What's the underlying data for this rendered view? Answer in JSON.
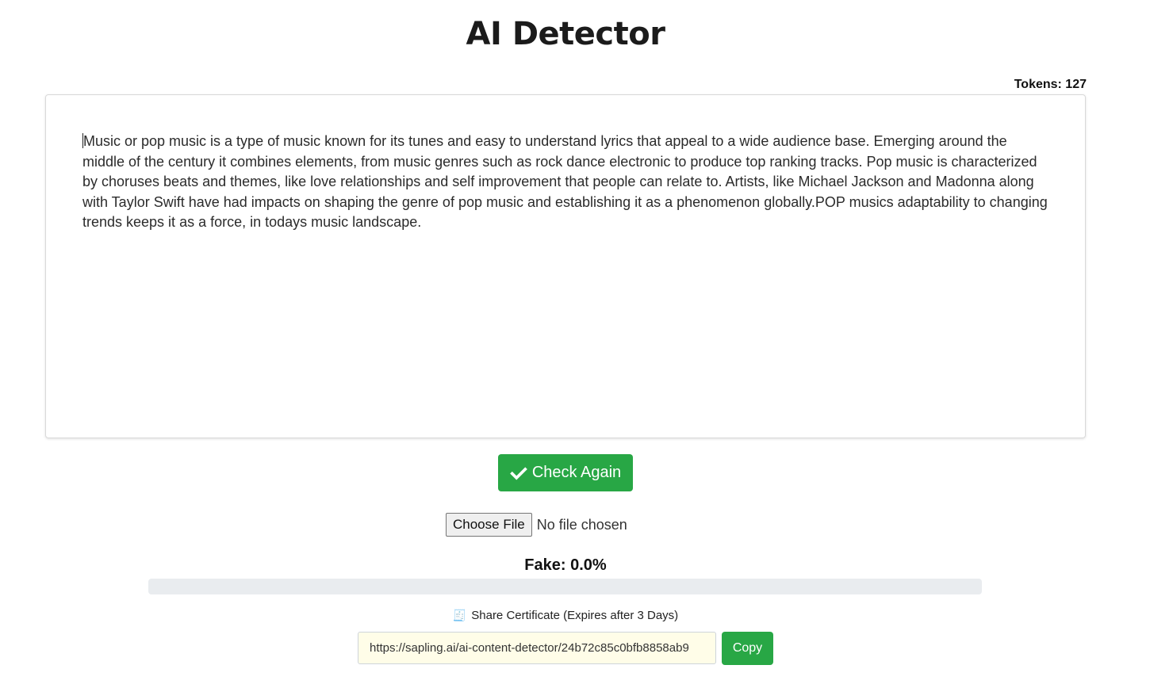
{
  "header": {
    "title": "AI Detector"
  },
  "editor": {
    "tokens_label": "Tokens: 127",
    "text": "Music or pop music is a type of music known for its tunes and easy to understand lyrics that appeal to a wide audience base. Emerging around the middle of the century it combines elements, from music genres such as rock dance electronic to produce top ranking tracks. Pop music is characterized by choruses beats and themes, like love relationships and self improvement that people can relate to. Artists, like Michael Jackson and Madonna along with Taylor Swift have had impacts on shaping the genre of pop music and establishing it as a phenomenon globally.POP musics adaptability to changing trends keeps it as a force, in todays music landscape."
  },
  "actions": {
    "check_label": "Check Again",
    "check_icon": "checkmark-icon"
  },
  "file_upload": {
    "button_label": "Choose File",
    "status": "No file chosen"
  },
  "result": {
    "fake_label": "Fake: 0.0%",
    "fake_fraction": 0.0
  },
  "share": {
    "icon": "receipt-icon",
    "label": "Share Certificate (Expires after 3 Days)",
    "url": "https://sapling.ai/ai-content-detector/24b72c85c0bfb8858ab9",
    "copy_label": "Copy"
  },
  "colors": {
    "accent_green": "#28a745",
    "progress_track": "#e9ecef",
    "url_background": "#fffde8"
  }
}
